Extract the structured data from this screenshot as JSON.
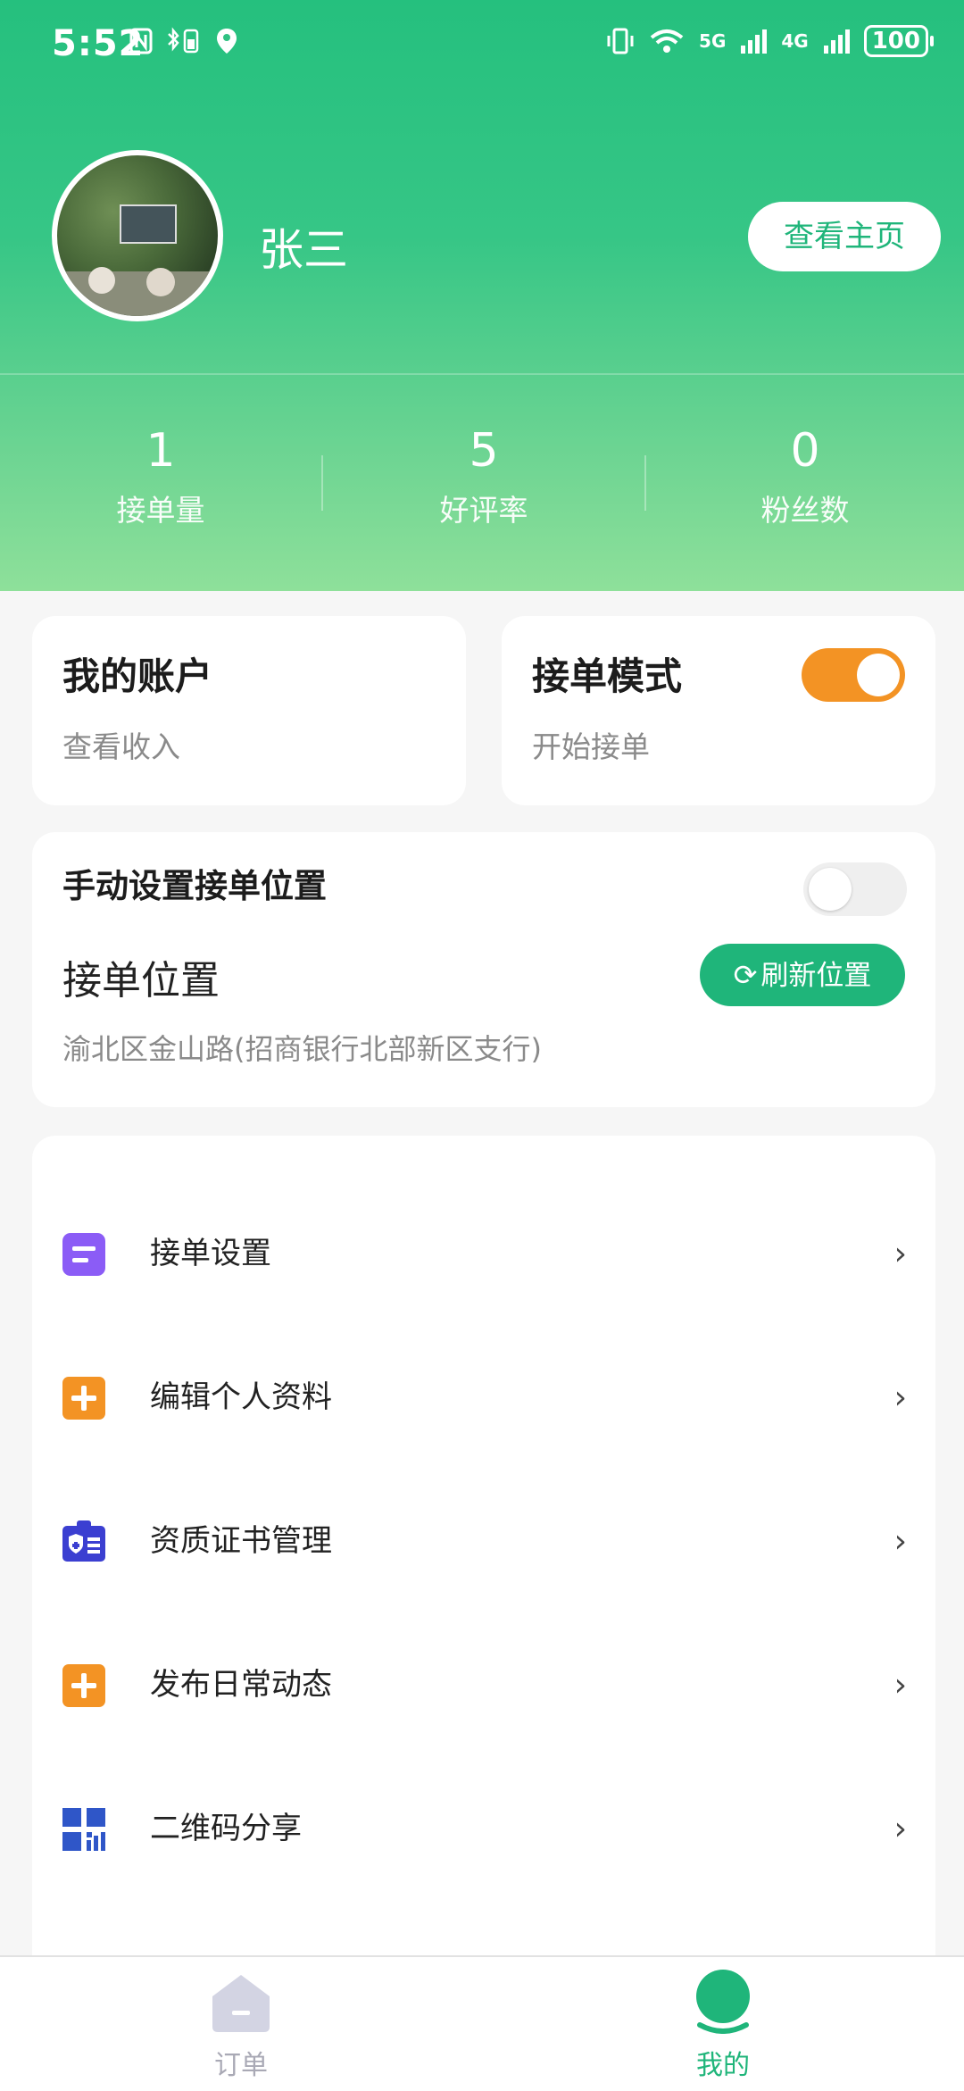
{
  "status_bar": {
    "time": "5:52",
    "left_icons": [
      "nfc-icon",
      "bluetooth-battery-icon",
      "location-icon"
    ],
    "net1": "5G",
    "net2": "4G",
    "battery": "100"
  },
  "profile": {
    "name": "张三",
    "homepage_button": "查看主页"
  },
  "stats": [
    {
      "value": "1",
      "label": "接单量"
    },
    {
      "value": "5",
      "label": "好评率"
    },
    {
      "value": "0",
      "label": "粉丝数"
    }
  ],
  "account_card": {
    "title": "我的账户",
    "subtitle": "查看收入"
  },
  "mode_card": {
    "title": "接单模式",
    "subtitle": "开始接单",
    "toggle_on": true
  },
  "location_card": {
    "manual_title": "手动设置接单位置",
    "manual_toggle_on": false,
    "location_label": "接单位置",
    "refresh_button": "刷新位置",
    "address": "渝北区金山路(招商银行北部新区支行)"
  },
  "menu": [
    {
      "label": "接单设置",
      "icon": "order-settings-icon",
      "color": "#8b5cf6"
    },
    {
      "label": "编辑个人资料",
      "icon": "plus-icon",
      "color": "#f39324"
    },
    {
      "label": "资质证书管理",
      "icon": "certificate-icon",
      "color": "#3b3fd1"
    },
    {
      "label": "发布日常动态",
      "icon": "plus-icon",
      "color": "#f39324"
    },
    {
      "label": "二维码分享",
      "icon": "qrcode-icon",
      "color": "#2f56c8"
    }
  ],
  "tabs": [
    {
      "label": "订单",
      "active": false
    },
    {
      "label": "我的",
      "active": true
    }
  ],
  "colors": {
    "brand_green": "#1fb57a",
    "toggle_orange": "#f39324"
  }
}
